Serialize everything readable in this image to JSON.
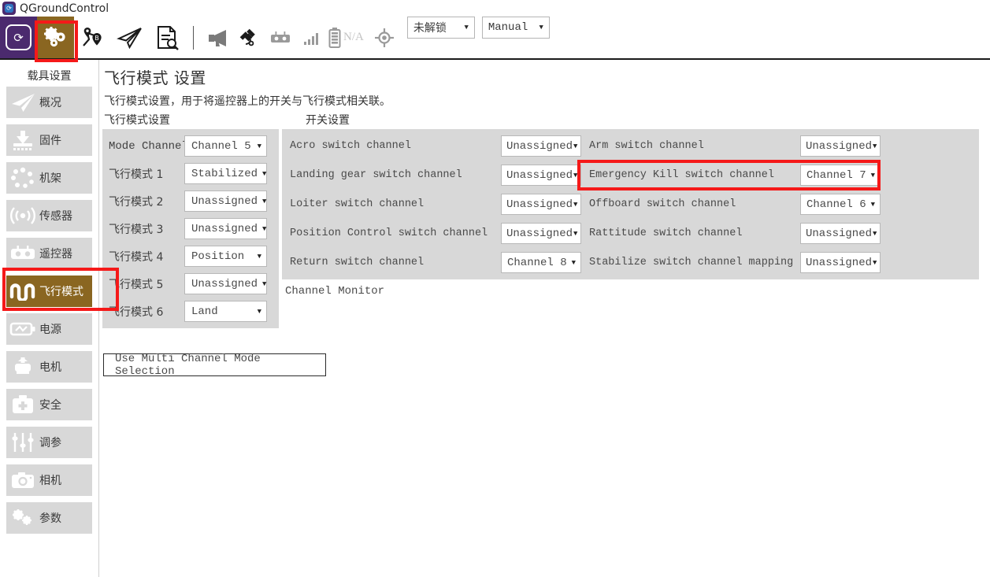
{
  "window": {
    "title": "QGroundControl",
    "logo_icon": "qgc-logo-icon"
  },
  "toolbar": {
    "items": [
      {
        "name": "qgc-logo-button",
        "icon": "qgc-logo-icon"
      },
      {
        "name": "toolbar-settings-button",
        "icon": "gears-icon",
        "active": true
      },
      {
        "name": "toolbar-plan-button",
        "icon": "plan-waypoints-icon"
      },
      {
        "name": "toolbar-fly-button",
        "icon": "paper-plane-icon"
      },
      {
        "name": "toolbar-analyze-button",
        "icon": "document-search-icon"
      },
      {
        "name": "toolbar-messages-button",
        "icon": "megaphone-icon"
      },
      {
        "name": "toolbar-gps-button",
        "icon": "satellite-icon"
      },
      {
        "name": "toolbar-rc-button",
        "icon": "rc-transmitter-icon"
      },
      {
        "name": "toolbar-signal-button",
        "icon": "signal-bars-icon"
      },
      {
        "name": "toolbar-battery-button",
        "icon": "battery-icon"
      },
      {
        "name": "toolbar-gps-fix-button",
        "icon": "crosshair-icon"
      }
    ],
    "battery_value": "N/A",
    "arm_state": "未解锁",
    "flight_mode": "Manual",
    "dropdown_arrow": "▼"
  },
  "sidebar": {
    "title": "载具设置",
    "items": [
      {
        "label": "概况",
        "icon": "paper-plane-icon",
        "selected": false
      },
      {
        "label": "固件",
        "icon": "firmware-download-icon",
        "selected": false
      },
      {
        "label": "机架",
        "icon": "airframe-dots-icon",
        "selected": false
      },
      {
        "label": "传感器",
        "icon": "sensors-waves-icon",
        "selected": false
      },
      {
        "label": "遥控器",
        "icon": "rc-transmitter-icon",
        "selected": false
      },
      {
        "label": "飞行模式",
        "icon": "flight-modes-wave-icon",
        "selected": true
      },
      {
        "label": "电源",
        "icon": "power-battery-icon",
        "selected": false
      },
      {
        "label": "电机",
        "icon": "motors-icon",
        "selected": false
      },
      {
        "label": "安全",
        "icon": "safety-case-icon",
        "selected": false
      },
      {
        "label": "调参",
        "icon": "tuning-sliders-icon",
        "selected": false
      },
      {
        "label": "相机",
        "icon": "camera-icon",
        "selected": false
      },
      {
        "label": "参数",
        "icon": "parameters-gears-icon",
        "selected": false
      }
    ]
  },
  "page": {
    "title": "飞行模式 设置",
    "description": "飞行模式设置，用于将遥控器上的开关与飞行模式相关联。",
    "section_flight_modes": "飞行模式设置",
    "section_switches": "开关设置",
    "channel_monitor": "Channel Monitor",
    "multi_channel_button": "Use Multi Channel Mode Selection",
    "dropdown_arrow": "▼"
  },
  "flight_modes": {
    "rows": [
      {
        "label": "Mode Channel",
        "value": "Channel 5",
        "label_type": "mono"
      },
      {
        "label": "飞行模式 1",
        "value": "Stabilized",
        "label_type": "cn"
      },
      {
        "label": "飞行模式 2",
        "value": "Unassigned",
        "label_type": "cn"
      },
      {
        "label": "飞行模式 3",
        "value": "Unassigned",
        "label_type": "cn"
      },
      {
        "label": "飞行模式 4",
        "value": "Position",
        "label_type": "cn"
      },
      {
        "label": "飞行模式 5",
        "value": "Unassigned",
        "label_type": "cn"
      },
      {
        "label": "飞行模式 6",
        "value": "Land",
        "label_type": "cn"
      }
    ]
  },
  "switch_settings": {
    "left_column": [
      {
        "label": "Acro switch channel",
        "value": "Unassigned"
      },
      {
        "label": "Landing gear switch channel",
        "value": "Unassigned"
      },
      {
        "label": "Loiter switch channel",
        "value": "Unassigned"
      },
      {
        "label": "Position Control switch channel",
        "value": "Unassigned"
      },
      {
        "label": "Return switch channel",
        "value": "Channel 8"
      }
    ],
    "right_column": [
      {
        "label": "Arm switch channel",
        "value": "Unassigned",
        "highlighted": false
      },
      {
        "label": "Emergency Kill switch channel",
        "value": "Channel 7",
        "highlighted": true
      },
      {
        "label": "Offboard switch channel",
        "value": "Channel 6",
        "highlighted": false
      },
      {
        "label": "Rattitude switch channel",
        "value": "Unassigned",
        "highlighted": false
      },
      {
        "label": "Stabilize switch channel mapping",
        "value": "Unassigned",
        "highlighted": false
      }
    ]
  },
  "annotations": {
    "highlight_color": "#f51919",
    "boxes": [
      {
        "name": "redbox-toolbar-settings"
      },
      {
        "name": "redbox-sidebar-flight-modes"
      },
      {
        "name": "redbox-emergency-kill-row"
      }
    ]
  },
  "colors": {
    "accent_brown": "#8a6621",
    "logo_purple": "#4b2a6e",
    "panel_gray": "#d8d8d8",
    "highlight_red": "#f51919"
  }
}
